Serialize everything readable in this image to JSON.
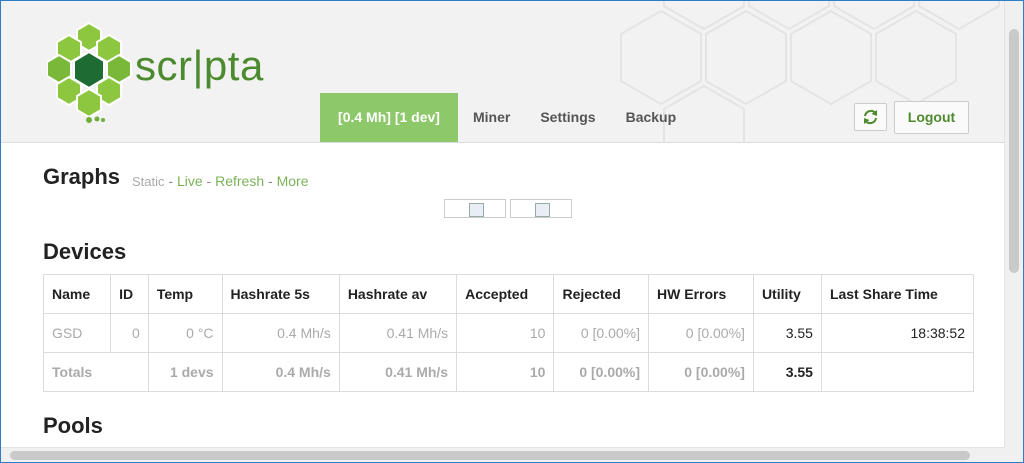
{
  "brand": {
    "name_left": "scr",
    "name_sep": "|",
    "name_right": "pta"
  },
  "nav": {
    "items": [
      {
        "label": "[0.4 Mh] [1 dev]",
        "active": true
      },
      {
        "label": "Miner"
      },
      {
        "label": "Settings"
      },
      {
        "label": "Backup"
      }
    ]
  },
  "header_actions": {
    "refresh_icon": "refresh-icon",
    "logout_label": "Logout"
  },
  "graphs": {
    "title": "Graphs",
    "links": {
      "static": "Static",
      "live": "Live",
      "refresh": "Refresh",
      "more": "More",
      "sep": " - "
    }
  },
  "devices": {
    "title": "Devices",
    "columns": [
      "Name",
      "ID",
      "Temp",
      "Hashrate 5s",
      "Hashrate av",
      "Accepted",
      "Rejected",
      "HW Errors",
      "Utility",
      "Last Share Time"
    ],
    "rows": [
      [
        "GSD",
        "0",
        "0 °C",
        "0.4 Mh/s",
        "0.41 Mh/s",
        "10",
        "0 [0.00%]",
        "0 [0.00%]",
        "3.55",
        "18:38:52"
      ]
    ],
    "totals": [
      "Totals",
      "1 devs",
      "0.4 Mh/s",
      "0.41 Mh/s",
      "10",
      "0 [0.00%]",
      "0 [0.00%]",
      "3.55",
      ""
    ]
  },
  "pools": {
    "title": "Pools"
  },
  "colors": {
    "accent": "#8dc86a",
    "brand_green": "#4c8a2f",
    "link_green": "#7bb35a"
  }
}
